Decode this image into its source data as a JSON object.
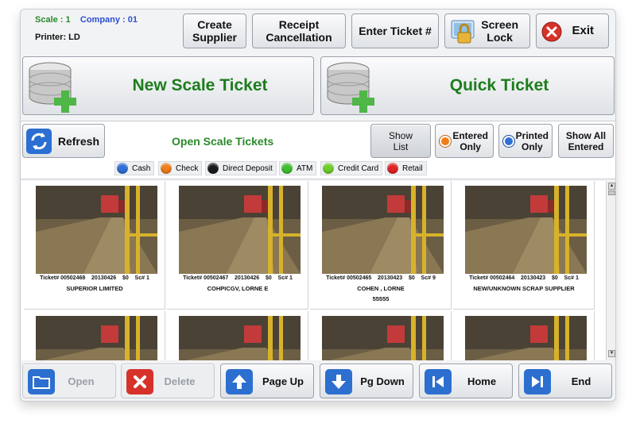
{
  "header": {
    "scale_label": "Scale : 1",
    "company_label": "Company : 01",
    "printer_label": "Printer: LD",
    "create_supplier": [
      "Create",
      "Supplier"
    ],
    "receipt_cancellation": [
      "Receipt",
      "Cancellation"
    ],
    "enter_ticket": "Enter Ticket #",
    "screen_lock": [
      "Screen",
      "Lock"
    ],
    "exit": "Exit"
  },
  "actions": {
    "new_scale_ticket": "New Scale Ticket",
    "quick_ticket": "Quick Ticket"
  },
  "toolbar": {
    "refresh": "Refresh",
    "section_title": "Open Scale Tickets",
    "show_list": [
      "Show",
      "List"
    ],
    "entered_only": [
      "Entered",
      "Only"
    ],
    "printed_only": [
      "Printed",
      "Only"
    ],
    "show_all_entered": [
      "Show All",
      "Entered"
    ]
  },
  "legend": [
    {
      "label": "Cash",
      "color": "#2f6fd6"
    },
    {
      "label": "Check",
      "color": "#ef7d1a"
    },
    {
      "label": "Direct Deposit",
      "color": "#1a1a1a"
    },
    {
      "label": "ATM",
      "color": "#3fbf2f"
    },
    {
      "label": "Credit Card",
      "color": "#6fcf2a"
    },
    {
      "label": "Retail",
      "color": "#e02424"
    }
  ],
  "tickets": [
    {
      "ticket": "Ticket# 00502468",
      "date": "20130426",
      "amount": "$0",
      "sc": "Sc# 1",
      "name": "SUPERIOR LIMITED",
      "extra": ""
    },
    {
      "ticket": "Ticket# 00502467",
      "date": "20130426",
      "amount": "$0",
      "sc": "Sc# 1",
      "name": "COHPICGV, LORNE E",
      "extra": ""
    },
    {
      "ticket": "Ticket# 00502465",
      "date": "20130423",
      "amount": "$0",
      "sc": "Sc# 9",
      "name": "COHEN , LORNE",
      "extra": "55555"
    },
    {
      "ticket": "Ticket# 00502464",
      "date": "20130423",
      "amount": "$0",
      "sc": "Sc# 1",
      "name": "NEW/UNKNOWN SCRAP SUPPLIER",
      "extra": ""
    }
  ],
  "footer": {
    "open": "Open",
    "delete": "Delete",
    "page_up": "Page Up",
    "pg_down": "Pg Down",
    "home": "Home",
    "end": "End"
  }
}
